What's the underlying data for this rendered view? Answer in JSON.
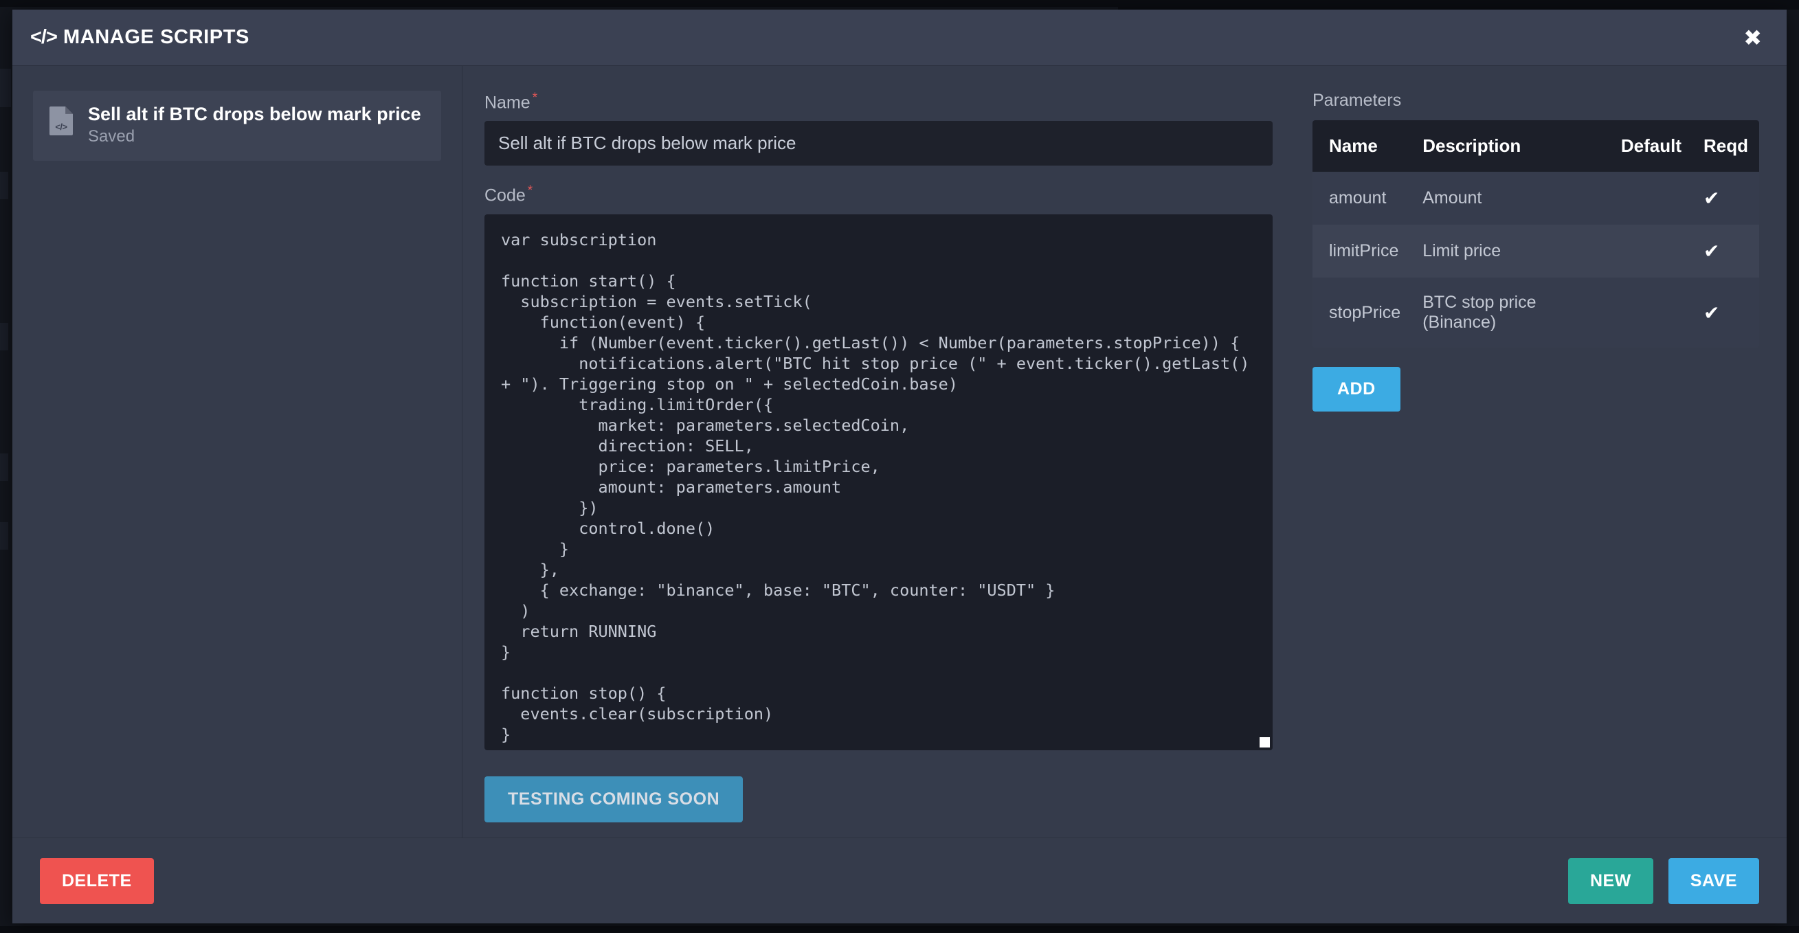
{
  "window": {
    "title": "MANAGE SCRIPTS",
    "code_icon": "</>",
    "close_icon": "✖"
  },
  "script_list": {
    "items": [
      {
        "name": "Sell alt if BTC drops below mark price",
        "status": "Saved",
        "icon": "</>"
      }
    ]
  },
  "form": {
    "name_label": "Name",
    "name_required_marker": "*",
    "name_value": "Sell alt if BTC drops below mark price",
    "name_placeholder": "Name",
    "code_label": "Code",
    "code_required_marker": "*",
    "code_value": "var subscription\n\nfunction start() {\n  subscription = events.setTick(\n    function(event) {\n      if (Number(event.ticker().getLast()) < Number(parameters.stopPrice)) {\n        notifications.alert(\"BTC hit stop price (\" + event.ticker().getLast() + \"). Triggering stop on \" + selectedCoin.base)\n        trading.limitOrder({\n          market: parameters.selectedCoin,\n          direction: SELL,\n          price: parameters.limitPrice,\n          amount: parameters.amount\n        })\n        control.done()\n      }\n    },\n    { exchange: \"binance\", base: \"BTC\", counter: \"USDT\" }\n  )\n  return RUNNING\n}\n\nfunction stop() {\n  events.clear(subscription)\n}",
    "test_button_label": "TESTING COMING SOON"
  },
  "parameters": {
    "title": "Parameters",
    "columns": [
      "Name",
      "Description",
      "Default",
      "Reqd"
    ],
    "rows": [
      {
        "name": "amount",
        "description": "Amount",
        "default": "",
        "reqd": "✔"
      },
      {
        "name": "limitPrice",
        "description": "Limit price",
        "default": "",
        "reqd": "✔"
      },
      {
        "name": "stopPrice",
        "description": "BTC stop price (Binance)",
        "default": "",
        "reqd": "✔"
      }
    ],
    "add_button_label": "ADD"
  },
  "footer": {
    "delete_label": "DELETE",
    "new_label": "NEW",
    "save_label": "SAVE"
  },
  "colors": {
    "accent_blue": "#3cabe3",
    "accent_green": "#29a798",
    "accent_red": "#ef5350",
    "test_blue": "#3d8fb8",
    "modal_bg": "#353b4b",
    "input_bg": "#1e212b",
    "code_bg": "#1b1e28"
  }
}
